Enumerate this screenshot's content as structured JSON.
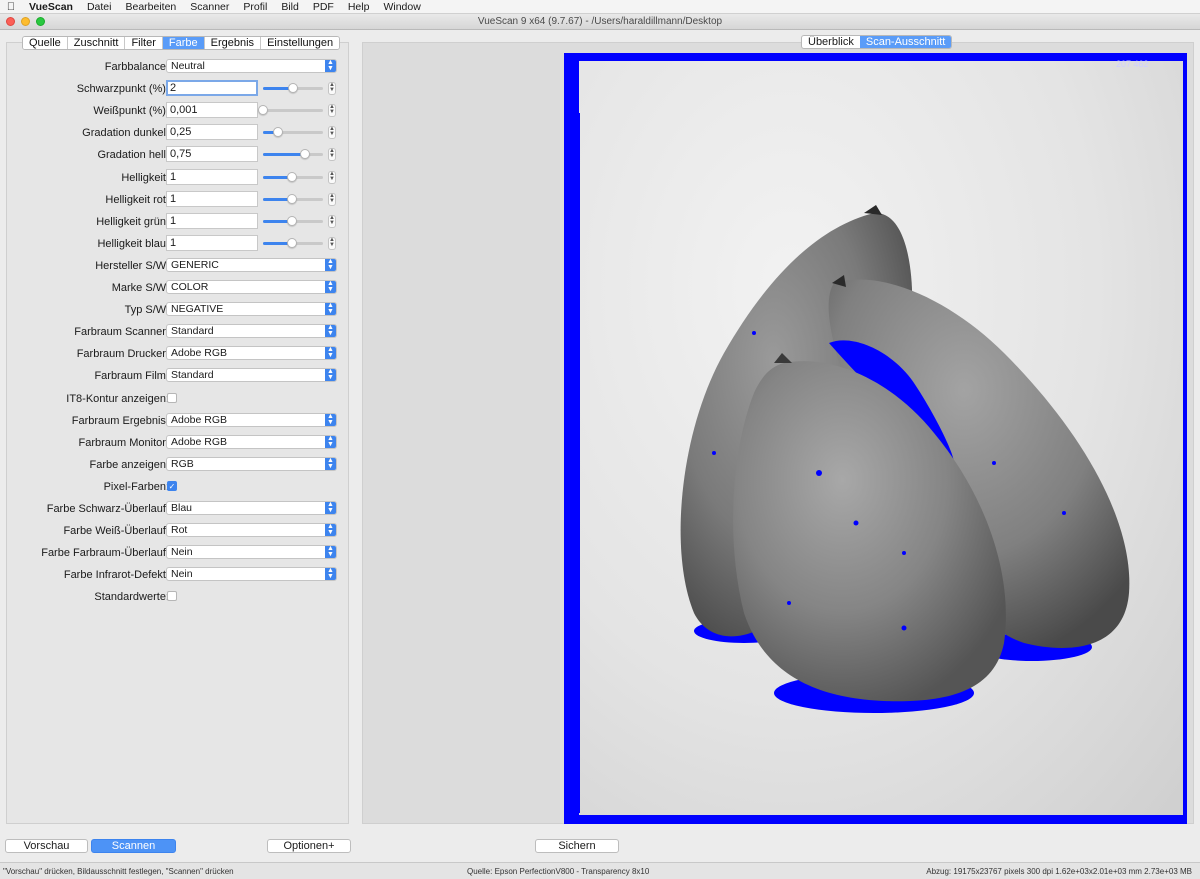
{
  "menubar": {
    "app": "VueScan",
    "items": [
      "Datei",
      "Bearbeiten",
      "Scanner",
      "Profil",
      "Bild",
      "PDF",
      "Help",
      "Window"
    ]
  },
  "window": {
    "title": "VueScan 9 x64 (9.7.67) - /Users/haraldillmann/Desktop"
  },
  "tabs": [
    {
      "label": "Quelle",
      "active": false
    },
    {
      "label": "Zuschnitt",
      "active": false
    },
    {
      "label": "Filter",
      "active": false
    },
    {
      "label": "Farbe",
      "active": true
    },
    {
      "label": "Ergebnis",
      "active": false
    },
    {
      "label": "Einstellungen",
      "active": false
    }
  ],
  "view_tabs": [
    {
      "label": "Überblick",
      "active": false
    },
    {
      "label": "Scan-Ausschnitt",
      "active": true
    }
  ],
  "settings": [
    {
      "label": "Farbbalance:",
      "type": "select",
      "value": "Neutral"
    },
    {
      "label": "Schwarzpunkt (%):",
      "type": "slider",
      "value": "2",
      "level": 0.5,
      "focused": true
    },
    {
      "label": "Weißpunkt (%):",
      "type": "slider",
      "value": "0,001",
      "level": 0.0
    },
    {
      "label": "Gradation dunkel:",
      "type": "slider",
      "value": "0,25",
      "level": 0.25
    },
    {
      "label": "Gradation hell:",
      "type": "slider",
      "value": "0,75",
      "level": 0.7
    },
    {
      "label": "Helligkeit:",
      "type": "slider",
      "value": "1",
      "level": 0.48
    },
    {
      "label": "Helligkeit rot:",
      "type": "slider",
      "value": "1",
      "level": 0.48
    },
    {
      "label": "Helligkeit grün:",
      "type": "slider",
      "value": "1",
      "level": 0.48
    },
    {
      "label": "Helligkeit blau:",
      "type": "slider",
      "value": "1",
      "level": 0.48
    },
    {
      "label": "Hersteller S/W:",
      "type": "select",
      "value": "GENERIC"
    },
    {
      "label": "Marke S/W:",
      "type": "select",
      "value": "COLOR"
    },
    {
      "label": "Typ S/W:",
      "type": "select",
      "value": "NEGATIVE"
    },
    {
      "label": "Farbraum Scanner:",
      "type": "select",
      "value": "Standard"
    },
    {
      "label": "Farbraum Drucker:",
      "type": "select",
      "value": "Adobe RGB"
    },
    {
      "label": "Farbraum Film:",
      "type": "select",
      "value": "Standard"
    },
    {
      "label": "IT8-Kontur anzeigen:",
      "type": "check",
      "checked": false
    },
    {
      "label": "Farbraum Ergebnis:",
      "type": "select",
      "value": "Adobe RGB"
    },
    {
      "label": "Farbraum Monitor:",
      "type": "select",
      "value": "Adobe RGB"
    },
    {
      "label": "Farbe anzeigen:",
      "type": "select",
      "value": "RGB"
    },
    {
      "label": "Pixel-Farben:",
      "type": "check",
      "checked": true
    },
    {
      "label": "Farbe Schwarz-Überlauf:",
      "type": "select",
      "value": "Blau"
    },
    {
      "label": "Farbe Weiß-Überlauf:",
      "type": "select",
      "value": "Rot"
    },
    {
      "label": "Farbe Farbraum-Überlauf:",
      "type": "select",
      "value": "Nein"
    },
    {
      "label": "Farbe Infrarot-Defekt:",
      "type": "select",
      "value": "Nein"
    },
    {
      "label": "Standardwerte:",
      "type": "check",
      "checked": false
    }
  ],
  "preview": {
    "corner_text": "207 462"
  },
  "buttons": {
    "vorschau": "Vorschau",
    "scannen": "Scannen",
    "optionen": "Optionen+",
    "sichern": "Sichern"
  },
  "status": {
    "left": "\"Vorschau\" drücken, Bildausschnitt festlegen, \"Scannen\" drücken",
    "center": "Quelle: Epson PerfectionV800 - Transparency 8x10",
    "right": "Abzug: 19175x23767 pixels 300 dpi 1.62e+03x2.01e+03 mm 2.73e+03 MB"
  },
  "colors": {
    "accent": "#3d84ee",
    "overflow_black": "#0000ff"
  },
  "icons": {
    "apple": "apple-icon",
    "select_arrow": "chevron-updown-icon",
    "stepper": "stepper-icon"
  }
}
